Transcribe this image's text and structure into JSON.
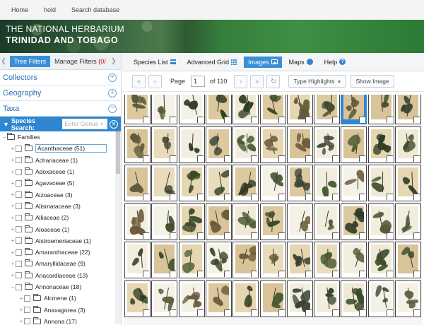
{
  "topnav": {
    "items": [
      "Home",
      "hold",
      "Search database"
    ]
  },
  "banner": {
    "line1": "THE NATIONAL HERBARIUM",
    "line2": "TRINIDAD AND TOBAGO"
  },
  "left_panel": {
    "filter_tabs": {
      "active": "Tree Filters",
      "manage": "Manage Filters",
      "manage_count": "(0/"
    },
    "sections": [
      "Collectors",
      "Geography",
      "Taxa"
    ],
    "species_search": {
      "label": "Species Search:",
      "placeholder": "Enter Genus + "
    },
    "tree": {
      "root": "Families",
      "families": [
        "Acanthaceae (51)",
        "Achariaceae (1)",
        "Adoxaceae (1)",
        "Agavaceae (5)",
        "Aizoaceae (3)",
        "Alismataceae (3)",
        "Alliaceae (2)",
        "Aloaceae (1)",
        "Alstroemeriaceae (1)",
        "Amaranthaceae (22)",
        "Amaryllidaceae (9)",
        "Anacardiaceae (13)",
        "Annonaceae (18)"
      ],
      "children": [
        "Alcmene (1)",
        "Anaxagorea (3)",
        "Annona (17)"
      ]
    }
  },
  "view_tabs": {
    "species_list": "Species List",
    "advanced_grid": "Advanced Grid",
    "images": "Images",
    "maps": "Maps",
    "help": "Help"
  },
  "toolbar": {
    "page_label": "Page",
    "page_value": "1",
    "of_label": "of 110",
    "highlights": "Type Highlights",
    "show_image": "Show Image"
  },
  "grid": {
    "rows": 6,
    "cols": 11,
    "selected_index": 8
  },
  "colors": {
    "accent": "#2f86d0",
    "paper_light": "#f2eedf",
    "paper_tan": "#dcc9a0",
    "plant_dark": "#3b4a2a"
  }
}
